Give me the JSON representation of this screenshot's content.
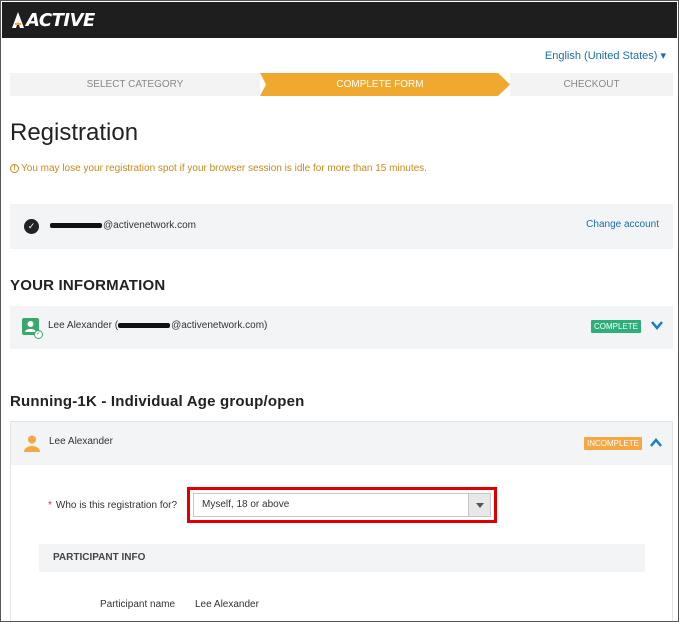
{
  "brand": {
    "logo_text": "ACTIVE"
  },
  "language": "English (United States)",
  "steps": [
    {
      "label": "SELECT CATEGORY",
      "state": "done"
    },
    {
      "label": "COMPLETE FORM",
      "state": "active"
    },
    {
      "label": "CHECKOUT",
      "state": "pending"
    }
  ],
  "page_title": "Registration",
  "session_warning": "You may lose your registration spot if your browser session is idle for more than 15 minutes.",
  "account": {
    "email_suffix": "@activenetwork.com",
    "change_label": "Change account"
  },
  "your_information": {
    "heading": "YOUR INFORMATION",
    "name": "Lee Alexander",
    "email_suffix": "@activenetwork.com)",
    "status": "COMPLETE"
  },
  "event": {
    "heading": "Running-1K - Individual Age group/open",
    "participant": "Lee Alexander",
    "status": "INCOMPLETE",
    "question_label": "Who is this registration for?",
    "question_required_mark": "*",
    "selected_option": "Myself, 18 or above",
    "section_title": "PARTICIPANT INFO",
    "participant_name_label": "Participant name",
    "participant_name_value": "Lee Alexander"
  },
  "colors": {
    "topbar": "#1e1e1e",
    "accent_orange": "#f0a92e",
    "link_blue": "#1a6fa8",
    "complete_green": "#2eae7a",
    "incomplete_orange": "#f4a742",
    "highlight_red": "#e00000"
  },
  "icons": {
    "account": "check-circle-icon",
    "your_info": "user-check-icon",
    "participant": "user-icon",
    "expand": "chevron-down-icon",
    "collapse": "chevron-up-icon",
    "warning": "info-circle-icon",
    "select": "caret-down-icon"
  }
}
